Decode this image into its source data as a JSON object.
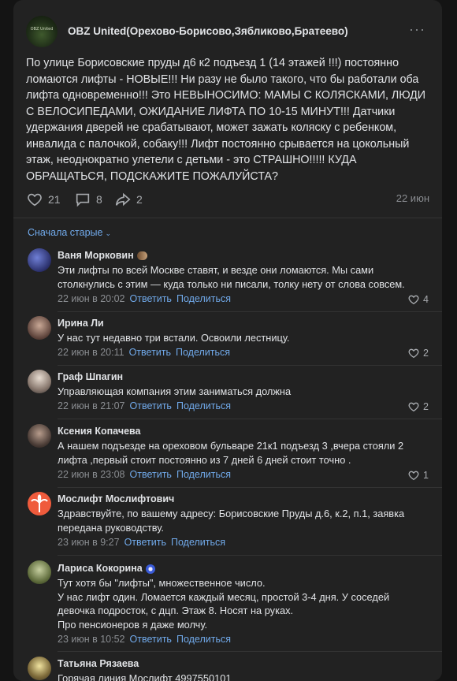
{
  "post": {
    "group_name": "OBZ United(Орехово-Борисово,Зябликово,Братеево)",
    "avatar_caption": "OBZ United",
    "text": "По улице Борисовские пруды д6 к2 подъезд 1 (14 этажей !!!) постоянно ломаются лифты - НОВЫЕ!!! Ни разу не было такого, что бы работали оба лифта одновременно!!! Это НЕВЫНОСИМО: МАМЫ С КОЛЯСКАМИ, ЛЮДИ С ВЕЛОСИПЕДАМИ, ОЖИДАНИЕ ЛИФТА ПО 10-15 МИНУТ!!! Датчики удержания дверей не срабатывают, может зажать коляску с ребенком, инвалида с палочкой, собаку!!! Лифт постоянно срывается на цокольный этаж, неоднократно улетели с детьми - это СТРАШНО!!!!! КУДА ОБРАЩАТЬСЯ, ПОДСКАЖИТЕ ПОЖАЛУЙСТА?",
    "likes": "21",
    "comments": "8",
    "shares": "2",
    "date": "22 июн"
  },
  "sort_label": "Сначала старые",
  "reply_label": "Ответить",
  "share_label": "Поделиться",
  "comments": [
    {
      "name": "Ваня Морковин",
      "text": "Эти лифты по всей Москве ставят, и везде они ломаются. Мы сами столкнулись с этим — куда только ни писали, толку нету от слова совсем.",
      "date": "22 июн в 20:02",
      "likes": "4"
    },
    {
      "name": "Ирина Ли",
      "text": "У нас тут недавно три встали. Освоили лестницу.",
      "date": "22 июн в 20:11",
      "likes": "2"
    },
    {
      "name": "Граф Шпагин",
      "text": "Управляющая компания этим заниматься должна",
      "date": "22 июн в 21:07",
      "likes": "2"
    },
    {
      "name": "Ксения Копачева",
      "text": "А нашем подъезде на ореховом бульваре 21к1 подъезд 3 ,вчера стояли 2 лифта ,первый стоит постоянно из 7 дней 6 дней стоит точно .",
      "date": "22 июн в 23:08",
      "likes": "1"
    },
    {
      "name": "Мослифт Мослифтович",
      "text": "Здравствуйте, по вашему адресу: Борисовские Пруды д.6, к.2, п.1, заявка передана руководству.",
      "date": "23 июн в 9:27",
      "likes": ""
    },
    {
      "name": "Лариса Кокорина",
      "text": "Тут хотя бы \"лифты\", множественное число.\nУ нас лифт один. Ломается каждый месяц, простой 3-4 дня. У соседей девочка подросток, с дцп. Этаж 8. Носят на руках.\nПро пенсионеров я даже молчу.",
      "date": "23 июн в 10:52",
      "likes": ""
    },
    {
      "name": "Татьяна Рязаева",
      "text": "Горячая линия Мослифт  4997550101",
      "date": "",
      "likes": ""
    }
  ],
  "colors": {
    "background": "#141414",
    "card": "#222222",
    "link": "#71aaeb",
    "muted": "#8a8d91"
  }
}
